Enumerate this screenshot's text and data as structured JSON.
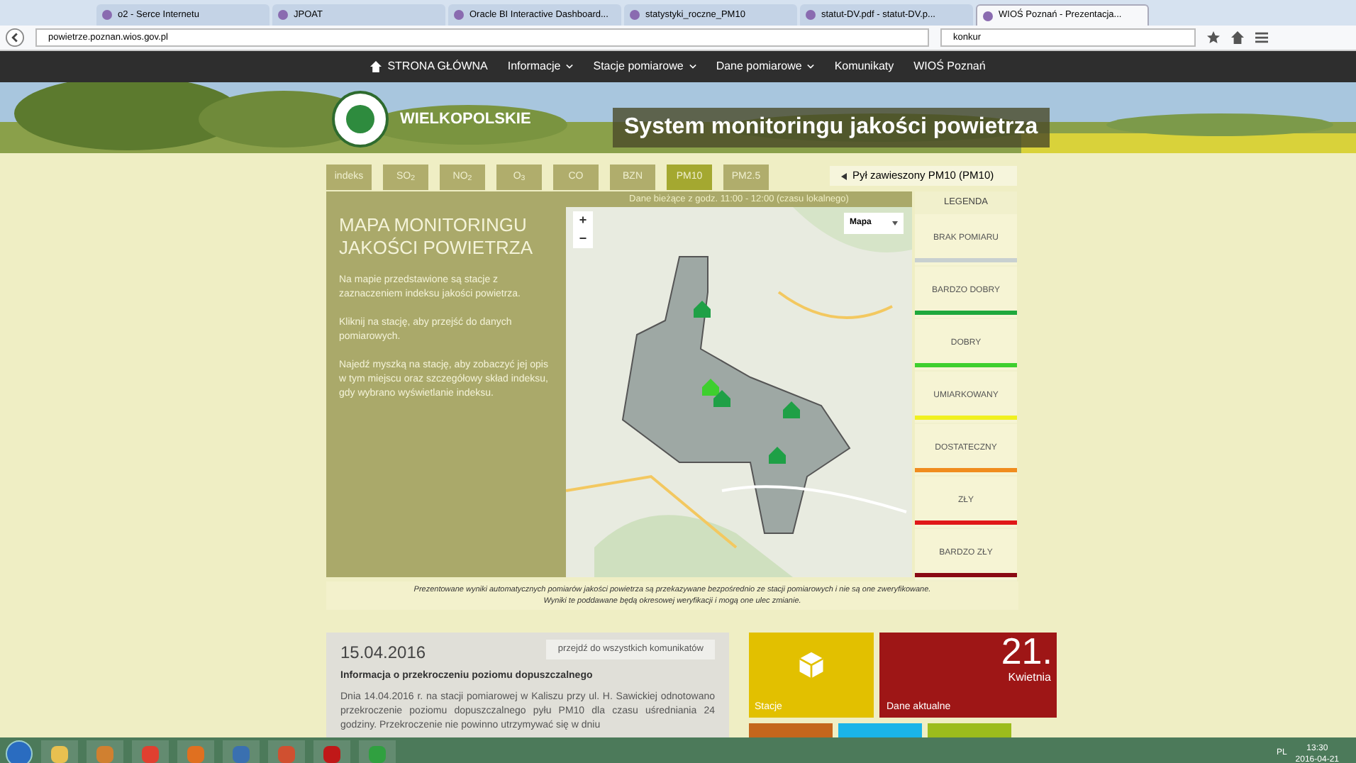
{
  "browser": {
    "tabs": [
      {
        "title": "o2 - Serce Internetu",
        "selected": false
      },
      {
        "title": "JPOAT",
        "selected": false
      },
      {
        "title": "Oracle BI Interactive Dashboard...",
        "selected": false
      },
      {
        "title": "statystyki_roczne_PM10",
        "selected": false
      },
      {
        "title": "statut-DV.pdf - statut-DV.p...",
        "selected": false
      },
      {
        "title": "WIOŚ Poznań - Prezentacja...",
        "selected": true
      }
    ],
    "address": "powietrze.poznan.wios.gov.pl",
    "search": "konkur"
  },
  "nav": [
    {
      "label": "STRONA GŁÓWNA",
      "kind": "home",
      "dropdown": false
    },
    {
      "label": "Informacje",
      "kind": "link",
      "dropdown": true
    },
    {
      "label": "Stacje pomiarowe",
      "kind": "link",
      "dropdown": true
    },
    {
      "label": "Dane pomiarowe",
      "kind": "link",
      "dropdown": true
    },
    {
      "label": "Komunikaty",
      "kind": "link",
      "dropdown": false
    },
    {
      "label": "WIOŚ Poznań",
      "kind": "link",
      "dropdown": false
    }
  ],
  "header": {
    "region": "WIELKOPOLSKIE",
    "title": "System monitoringu jakości powietrza"
  },
  "pollutant_tabs": [
    {
      "label": "indeks",
      "selected": false
    },
    {
      "label": "SO$_{2}$",
      "selected": false
    },
    {
      "label": "NO$_{2}$",
      "selected": false
    },
    {
      "label": "O$_{3}$",
      "selected": false
    },
    {
      "label": "CO",
      "selected": false
    },
    {
      "label": "BZN",
      "selected": false
    },
    {
      "label": "PM10",
      "selected": true
    },
    {
      "label": "PM2.5",
      "selected": false
    }
  ],
  "map_panel": {
    "heading": "MAPA MONITORINGU JAKOŚCI POWIETRZA",
    "paragraphs": [
      "Na mapie przedstawione są stacje z zaznaczeniem indeksu jakości powietrza.",
      "Kliknij na stację, aby przejść do danych pomiarowych.",
      "Najedź myszką na stację, aby zobaczyć jej opis w tym miejscu oraz szczegółowy skład indeksu, gdy wybrano wyświetlanie indeksu."
    ],
    "time_banner": "Dane bieżące z godz. 11:00 - 12:00 (czasu lokalnego)",
    "map_type": "Mapa",
    "zoom": [
      "+",
      "−"
    ]
  },
  "legend": {
    "title": "Pył zawieszony PM10 (PM10)",
    "heading": "LEGENDA",
    "items": [
      {
        "label": "BRAK POMIARU",
        "color": "#c8d0d0"
      },
      {
        "label": "BARDZO DOBRY",
        "color": "#1ea83c"
      },
      {
        "label": "DOBRY",
        "color": "#3ecf2e"
      },
      {
        "label": "UMIARKOWANY",
        "color": "#f0f020"
      },
      {
        "label": "DOSTATECZNY",
        "color": "#f08c1e"
      },
      {
        "label": "ZŁY",
        "color": "#e01818"
      },
      {
        "label": "BARDZO ZŁY",
        "color": "#8a0a14"
      }
    ]
  },
  "note": [
    "Prezentowane wyniki automatycznych pomiarów jakości powietrza są przekazywane bezpośrednio ze stacji pomiarowych i nie są one zweryfikowane.",
    "Wyniki te poddawane będą okresowej weryfikacji i mogą one ulec zmianie."
  ],
  "news": {
    "date": "15.04.2016",
    "link": "przejdź do wszystkich komunikatów",
    "title": "Informacja o przekroczeniu poziomu dopuszczalnego",
    "body": "Dnia 14.04.2016 r. na stacji pomiarowej w Kaliszu przy ul. H. Sawickiej odnotowano przekroczenie poziomu dopuszczalnego pyłu PM10 dla czasu uśredniania 24 godziny. Przekroczenie nie powinno utrzymywać się w dniu"
  },
  "tiles": [
    {
      "kind": "stations",
      "label": "Stacje"
    },
    {
      "kind": "date",
      "label": "Dane aktualne",
      "day": "21.",
      "month": "Kwietnia"
    }
  ],
  "taskbar": {
    "language": "PL",
    "time": "13:30",
    "date": "2016-04-21"
  }
}
